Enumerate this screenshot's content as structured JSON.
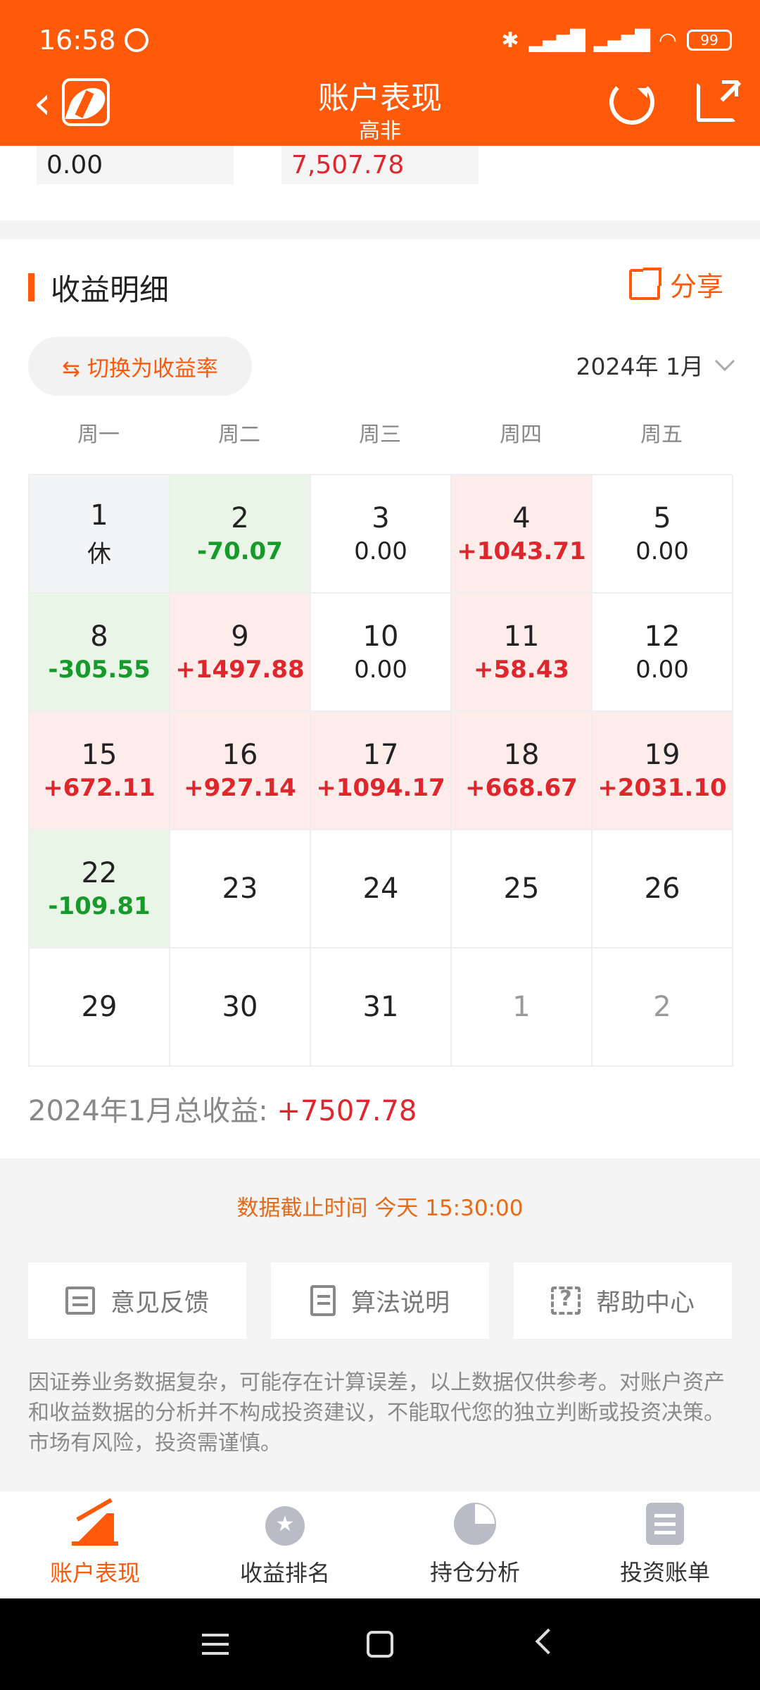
{
  "status_bar": {
    "time": "16:58",
    "battery": "99",
    "network": "HD"
  },
  "nav": {
    "title": "账户表现",
    "subtitle": "高非"
  },
  "top_values": {
    "left": "0.00",
    "right": "7,507.78"
  },
  "section": {
    "title": "收益明细",
    "share_label": "分享",
    "switch_label": "⇆ 切换为收益率",
    "month": "2024年 1月"
  },
  "weekdays": [
    "周一",
    "周二",
    "周三",
    "周四",
    "周五"
  ],
  "calendar": [
    {
      "day": "1",
      "value": "休",
      "type": "holiday"
    },
    {
      "day": "2",
      "value": "-70.07",
      "type": "neg"
    },
    {
      "day": "3",
      "value": "0.00",
      "type": "zero"
    },
    {
      "day": "4",
      "value": "+1043.71",
      "type": "pos"
    },
    {
      "day": "5",
      "value": "0.00",
      "type": "zero"
    },
    {
      "day": "8",
      "value": "-305.55",
      "type": "neg"
    },
    {
      "day": "9",
      "value": "+1497.88",
      "type": "pos"
    },
    {
      "day": "10",
      "value": "0.00",
      "type": "zero"
    },
    {
      "day": "11",
      "value": "+58.43",
      "type": "pos"
    },
    {
      "day": "12",
      "value": "0.00",
      "type": "zero"
    },
    {
      "day": "15",
      "value": "+672.11",
      "type": "pos"
    },
    {
      "day": "16",
      "value": "+927.14",
      "type": "pos"
    },
    {
      "day": "17",
      "value": "+1094.17",
      "type": "pos"
    },
    {
      "day": "18",
      "value": "+668.67",
      "type": "pos"
    },
    {
      "day": "19",
      "value": "+2031.10",
      "type": "pos"
    },
    {
      "day": "22",
      "value": "-109.81",
      "type": "neg"
    },
    {
      "day": "23",
      "value": "",
      "type": "empty"
    },
    {
      "day": "24",
      "value": "",
      "type": "empty"
    },
    {
      "day": "25",
      "value": "",
      "type": "empty"
    },
    {
      "day": "26",
      "value": "",
      "type": "empty"
    },
    {
      "day": "29",
      "value": "",
      "type": "empty"
    },
    {
      "day": "30",
      "value": "",
      "type": "empty"
    },
    {
      "day": "31",
      "value": "",
      "type": "empty"
    },
    {
      "day": "1",
      "value": "",
      "type": "other"
    },
    {
      "day": "2",
      "value": "",
      "type": "other"
    }
  ],
  "total": {
    "label": "2024年1月总收益: ",
    "value": "+7507.78"
  },
  "footer": {
    "cutoff": "数据截止时间 今天 15:30:00",
    "buttons": {
      "feedback": "意见反馈",
      "algorithm": "算法说明",
      "help": "帮助中心"
    },
    "disclaimer": "因证券业务数据复杂，可能存在计算误差，以上数据仅供参考。对账户资产和收益数据的分析并不构成投资建议，不能取代您的独立判断或投资决策。市场有风险，投资需谨慎。"
  },
  "tabs": {
    "performance": "账户表现",
    "ranking": "收益排名",
    "holdings": "持仓分析",
    "bill": "投资账单"
  },
  "colors": {
    "brand": "#ff5a0a",
    "gain": "#e0262d",
    "loss": "#169b2a"
  }
}
